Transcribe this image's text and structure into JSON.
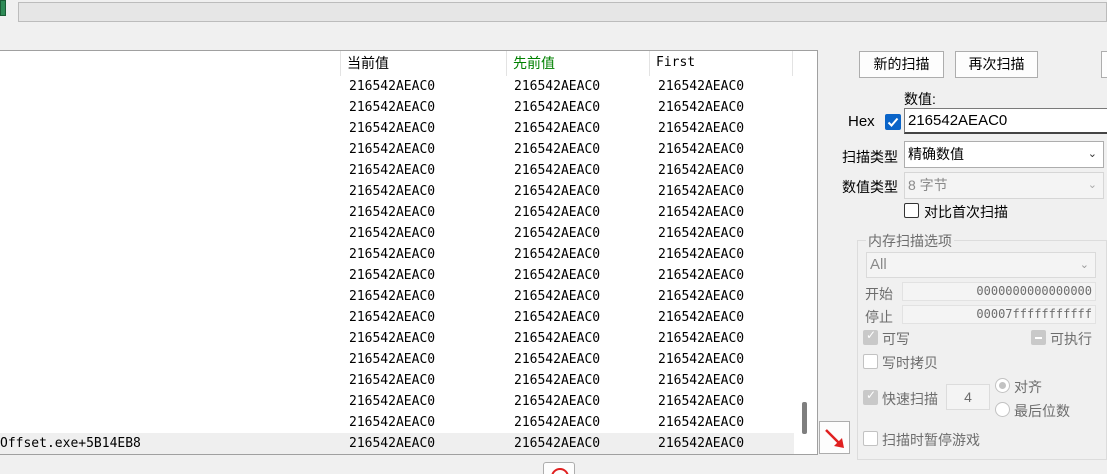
{
  "toolbar": {
    "icon": "save-icon"
  },
  "columns": {
    "current": "当前值",
    "previous": "先前值",
    "first": "First"
  },
  "rows": [
    {
      "address": "",
      "current": "216542AEAC0",
      "previous": "216542AEAC0",
      "first": "216542AEAC0"
    },
    {
      "address": "",
      "current": "216542AEAC0",
      "previous": "216542AEAC0",
      "first": "216542AEAC0"
    },
    {
      "address": "",
      "current": "216542AEAC0",
      "previous": "216542AEAC0",
      "first": "216542AEAC0"
    },
    {
      "address": "",
      "current": "216542AEAC0",
      "previous": "216542AEAC0",
      "first": "216542AEAC0"
    },
    {
      "address": "",
      "current": "216542AEAC0",
      "previous": "216542AEAC0",
      "first": "216542AEAC0"
    },
    {
      "address": "",
      "current": "216542AEAC0",
      "previous": "216542AEAC0",
      "first": "216542AEAC0"
    },
    {
      "address": "",
      "current": "216542AEAC0",
      "previous": "216542AEAC0",
      "first": "216542AEAC0"
    },
    {
      "address": "",
      "current": "216542AEAC0",
      "previous": "216542AEAC0",
      "first": "216542AEAC0"
    },
    {
      "address": "",
      "current": "216542AEAC0",
      "previous": "216542AEAC0",
      "first": "216542AEAC0"
    },
    {
      "address": "",
      "current": "216542AEAC0",
      "previous": "216542AEAC0",
      "first": "216542AEAC0"
    },
    {
      "address": "",
      "current": "216542AEAC0",
      "previous": "216542AEAC0",
      "first": "216542AEAC0"
    },
    {
      "address": "",
      "current": "216542AEAC0",
      "previous": "216542AEAC0",
      "first": "216542AEAC0"
    },
    {
      "address": "",
      "current": "216542AEAC0",
      "previous": "216542AEAC0",
      "first": "216542AEAC0"
    },
    {
      "address": "",
      "current": "216542AEAC0",
      "previous": "216542AEAC0",
      "first": "216542AEAC0"
    },
    {
      "address": "",
      "current": "216542AEAC0",
      "previous": "216542AEAC0",
      "first": "216542AEAC0"
    },
    {
      "address": "",
      "current": "216542AEAC0",
      "previous": "216542AEAC0",
      "first": "216542AEAC0"
    },
    {
      "address": "",
      "current": "216542AEAC0",
      "previous": "216542AEAC0",
      "first": "216542AEAC0"
    },
    {
      "address": "Offset.exe+5B14EB8",
      "current": "216542AEAC0",
      "previous": "216542AEAC0",
      "first": "216542AEAC0",
      "selected": true
    }
  ],
  "scan": {
    "new_scan": "新的扫描",
    "next_scan": "再次扫描",
    "value_label": "数值:",
    "hex_label": "Hex",
    "hex_checked": true,
    "value": "216542AEAC0",
    "scan_type_label": "扫描类型",
    "scan_type": "精确数值",
    "value_type_label": "数值类型",
    "value_type": "8 字节",
    "compare_first": "对比首次扫描"
  },
  "memory": {
    "title": "内存扫描选项",
    "region": "All",
    "start_label": "开始",
    "start": "0000000000000000",
    "stop_label": "停止",
    "stop": "00007fffffffffff",
    "writable": "可写",
    "executable": "可执行",
    "copy_on_write": "写时拷贝",
    "fast_scan": "快速扫描",
    "fast_scan_value": "4",
    "align": "对齐",
    "last_digits": "最后位数",
    "pause_game": "扫描时暂停游戏"
  },
  "colors": {
    "accent": "#0a64c8",
    "previous_header": "#008000",
    "arrow": "#e02020"
  }
}
